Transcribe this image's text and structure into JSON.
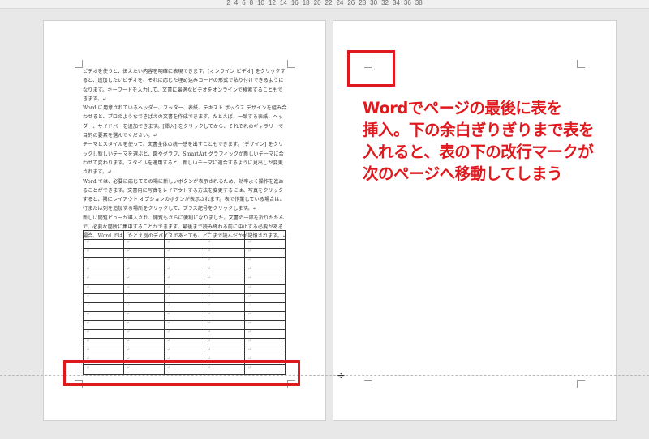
{
  "ruler": {
    "ticks": [
      "2",
      "4",
      "6",
      "8",
      "10",
      "12",
      "14",
      "16",
      "18",
      "20",
      "22",
      "24",
      "26",
      "28",
      "30",
      "32",
      "34",
      "36",
      "38"
    ]
  },
  "page1": {
    "paragraphs": [
      "ビデオを使うと、伝えたい内容を明確に表現できます。[オンライン ビデオ] をクリックすると、追加したいビデオを、それに応じた埋め込みコードの形式で貼り付けできるようになります。キーワードを入力して、文書に最適なビデオをオンラインで検索することもできます。↵",
      "Word に用意されているヘッダー、フッター、表紙、テキスト ボックス デザインを組み合わせると、プロのようなできばえの文書を作成できます。たとえば、一致する表紙、ヘッダー、サイドバーを追加できます。[挿入] をクリックしてから、それぞれのギャラリーで目的の要素を選んでください。↵",
      "テーマとスタイルを使って、文書全体の統一感を出すこともできます。[デザイン] をクリックし新しいテーマを選ぶと、図やグラフ、SmartArt グラフィックが新しいテーマに合わせて変わります。スタイルを適用すると、新しいテーマに適合するように見出しが変更されます。↵",
      "Word では、必要に応じてその場に新しいボタンが表示されるため、効率よく操作を進めることができます。文書内に写真をレイアウトする方法を変更するには、写真をクリックすると、隣にレイアウト オプションのボタンが表示されます。表で作業している場合は、行または列を追加する場所をクリックして、プラス記号をクリックします。↵",
      "新しい閲覧ビューが導入され、閲覧もさらに便利になりました。文書の一部を折りたたんで、必要な箇所に集中することができます。最後まで読み終わる前に中止する必要がある場合、Word では、たとえ別のデバイスであっても、どこまで読んだかが記憶されます。↵"
    ],
    "table": {
      "rows": 16,
      "cols": 5,
      "cell_mark": "↵",
      "row_end_mark": "↵"
    }
  },
  "annotation": {
    "lines": [
      "Wordでページの最後に表を",
      "挿入。下の余白ぎりぎりまで表を",
      "入れると、表の下の改行マークが",
      "次のページへ移動してしまう"
    ],
    "color": "#e0191f"
  },
  "page2": {
    "paragraph_mark": "↵"
  },
  "icons": {
    "page_break": "hide-white-space-icon"
  }
}
